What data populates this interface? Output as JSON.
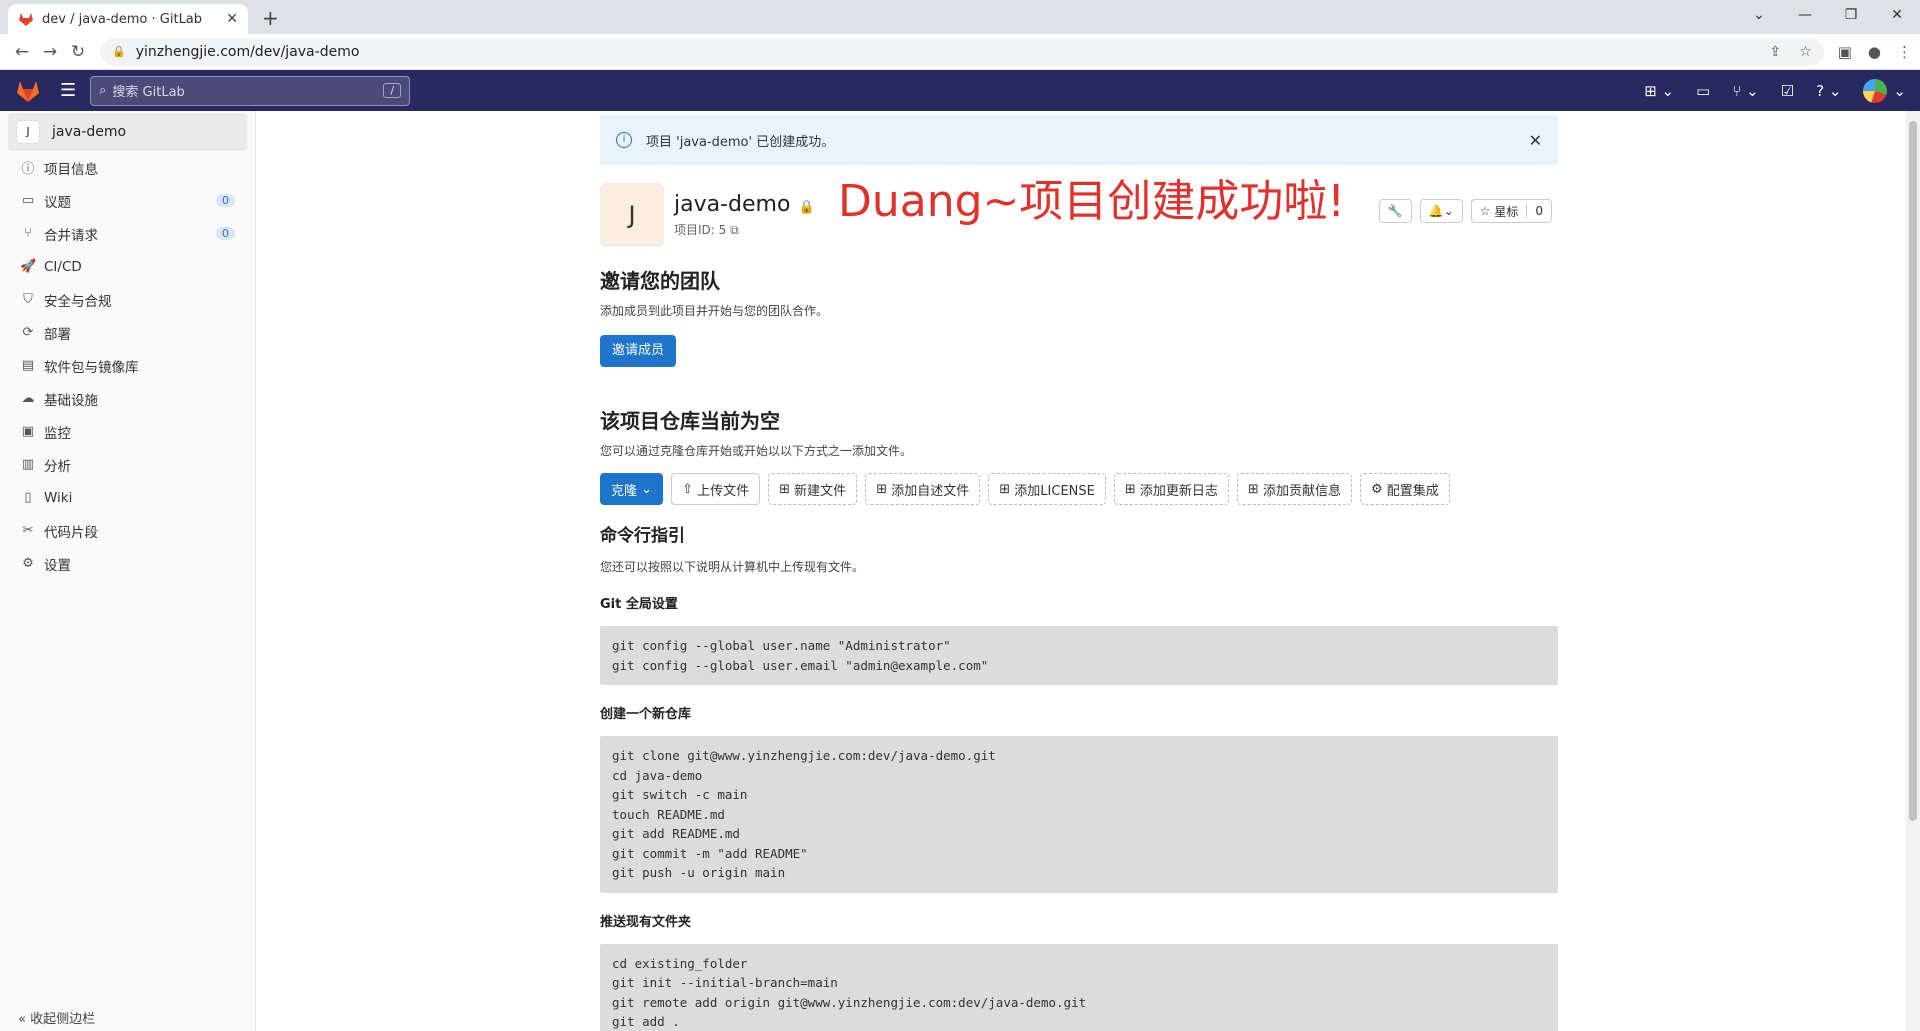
{
  "browser": {
    "tab_title": "dev / java-demo · GitLab",
    "url": "yinzhengjie.com/dev/java-demo"
  },
  "header": {
    "search_placeholder": "搜索 GitLab",
    "search_shortcut": "/"
  },
  "sidebar": {
    "project_initial": "J",
    "project_name": "java-demo",
    "items": [
      {
        "label": "项目信息",
        "icon": "info-icon"
      },
      {
        "label": "议题",
        "icon": "issues-icon",
        "count": "0"
      },
      {
        "label": "合并请求",
        "icon": "merge-request-icon",
        "count": "0"
      },
      {
        "label": "CI/CD",
        "icon": "rocket-icon"
      },
      {
        "label": "安全与合规",
        "icon": "shield-icon"
      },
      {
        "label": "部署",
        "icon": "deploy-icon"
      },
      {
        "label": "软件包与镜像库",
        "icon": "package-icon"
      },
      {
        "label": "基础设施",
        "icon": "cloud-icon"
      },
      {
        "label": "监控",
        "icon": "monitor-icon"
      },
      {
        "label": "分析",
        "icon": "chart-icon"
      },
      {
        "label": "Wiki",
        "icon": "book-icon"
      },
      {
        "label": "代码片段",
        "icon": "snippet-icon"
      },
      {
        "label": "设置",
        "icon": "gear-icon"
      }
    ],
    "collapse_label": "收起侧边栏"
  },
  "alert": {
    "text": "项目 'java-demo' 已创建成功。"
  },
  "project": {
    "initial": "J",
    "name": "java-demo",
    "id_label": "项目ID: 5",
    "banner": "Duang~项目创建成功啦!",
    "star_label": "星标",
    "star_count": "0"
  },
  "invite": {
    "title": "邀请您的团队",
    "desc": "添加成员到此项目并开始与您的团队合作。",
    "button": "邀请成员"
  },
  "empty": {
    "title": "该项目仓库当前为空",
    "desc": "您可以通过克隆仓库开始或开始以以下方式之一添加文件。",
    "buttons": {
      "clone": "克隆",
      "upload": "上传文件",
      "newfile": "新建文件",
      "readme": "添加自述文件",
      "license": "添加LICENSE",
      "changelog": "添加更新日志",
      "contrib": "添加贡献信息",
      "integration": "配置集成"
    }
  },
  "cli": {
    "title": "命令行指引",
    "desc": "您还可以按照以下说明从计算机中上传现有文件。",
    "global_label": "Git 全局设置",
    "global_code": "git config --global user.name \"Administrator\"\ngit config --global user.email \"admin@example.com\"",
    "new_label": "创建一个新仓库",
    "new_code": "git clone git@www.yinzhengjie.com:dev/java-demo.git\ncd java-demo\ngit switch -c main\ntouch README.md\ngit add README.md\ngit commit -m \"add README\"\ngit push -u origin main",
    "push_label": "推送现有文件夹",
    "push_code": "cd existing_folder\ngit init --initial-branch=main\ngit remote add origin git@www.yinzhengjie.com:dev/java-demo.git\ngit add .\ngit commit -m \"Initial commit\"\ngit push -u origin main"
  }
}
